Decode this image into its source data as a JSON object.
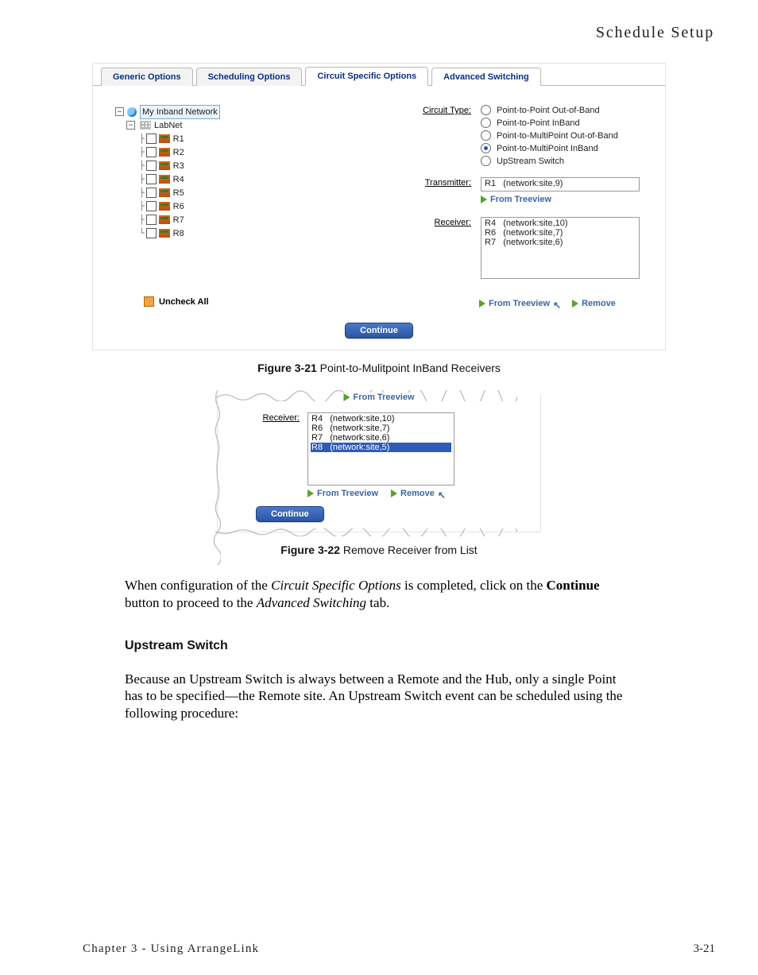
{
  "header_title": "Schedule Setup",
  "tabs": {
    "generic": "Generic Options",
    "scheduling": "Scheduling Options",
    "circuit": "Circuit Specific Options",
    "advanced": "Advanced Switching"
  },
  "tree": {
    "root_label": "My Inband Network",
    "network_label": "LabNet",
    "remotes": [
      "R1",
      "R2",
      "R3",
      "R4",
      "R5",
      "R6",
      "R7",
      "R8"
    ]
  },
  "labels": {
    "circuit_type": "Circuit Type:",
    "transmitter": "Transmitter:",
    "receiver": "Receiver:",
    "from_treeview": "From Treeview",
    "remove": "Remove",
    "uncheck_all": "Uncheck All",
    "continue": "Continue"
  },
  "circuit_types": {
    "p2p_oob": "Point-to-Point Out-of-Band",
    "p2p_ib": "Point-to-Point InBand",
    "p2mp_oob": "Point-to-MultiPoint Out-of-Band",
    "p2mp_ib": "Point-to-MultiPoint InBand",
    "upstream": "UpStream Switch"
  },
  "transmitter_rows": [
    "R1   (network:site,9)"
  ],
  "receiver_rows_fig1": [
    "R4   (network:site,10)",
    "R6   (network:site,7)",
    "R7   (network:site,6)"
  ],
  "fig1_caption_bold": "Figure 3-21",
  "fig1_caption_rest": "   Point-to-Mulitpoint InBand Receivers",
  "fig2_top_link": "From Treeview",
  "fig2_receiver_rows": [
    "R4   (network:site,10)",
    "R6   (network:site,7)",
    "R7   (network:site,6)",
    "R8   (network:site,5)"
  ],
  "fig2_selected_index": 3,
  "fig2_caption_bold": "Figure 3-22",
  "fig2_caption_rest": "   Remove Receiver from List",
  "para1_a": "When configuration of the ",
  "para1_em1": "Circuit Specific Options",
  "para1_b": " is completed, click on the ",
  "para1_bold": "Continue",
  "para1_c": " button to proceed to the ",
  "para1_em2": "Advanced Switching",
  "para1_d": " tab.",
  "subhead": "Upstream Switch",
  "para2": "Because an Upstream Switch is always between a Remote and the Hub, only a single Point has to be specified—the Remote site. An Upstream Switch event can be scheduled using the following procedure:",
  "footer_chapter": "Chapter 3 - Using ArrangeLink",
  "footer_page": "3-21"
}
